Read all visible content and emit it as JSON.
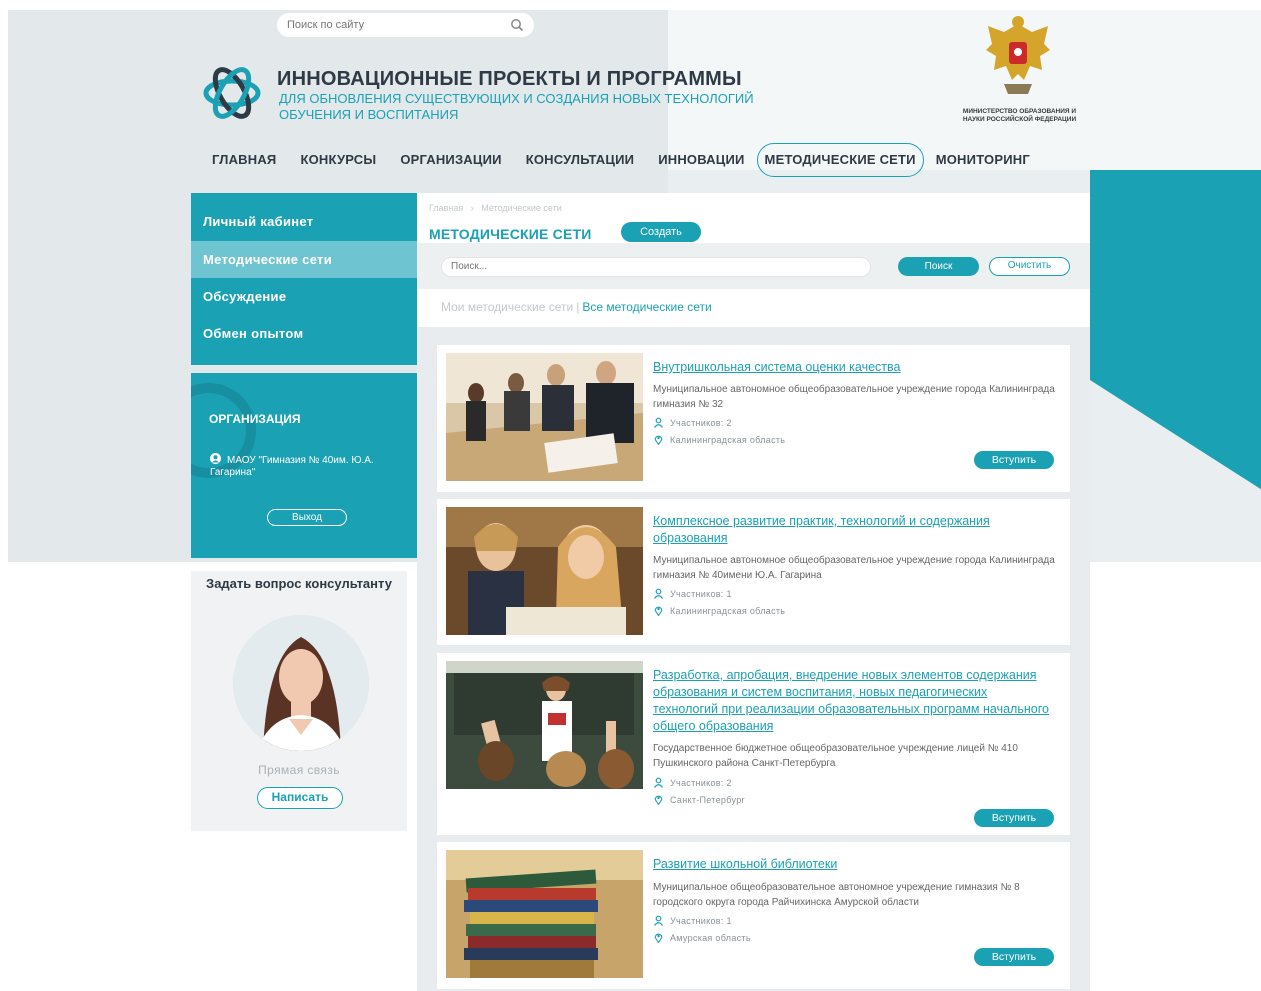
{
  "header": {
    "search_placeholder": "Поиск по сайту",
    "title": "ИННОВАЦИОННЫЕ ПРОЕКТЫ И ПРОГРАММЫ",
    "subtitle": "ДЛЯ ОБНОВЛЕНИЯ СУЩЕСТВУЮЩИХ И СОЗДАНИЯ НОВЫХ ТЕХНОЛОГИЙ ОБУЧЕНИЯ И ВОСПИТАНИЯ",
    "ministry": "МИНИСТЕРСТВО ОБРАЗОВАНИЯ И НАУКИ РОССИЙСКОЙ ФЕДЕРАЦИИ"
  },
  "nav": {
    "items": [
      {
        "label": "ГЛАВНАЯ"
      },
      {
        "label": "КОНКУРСЫ"
      },
      {
        "label": "ОРГАНИЗАЦИИ"
      },
      {
        "label": "КОНСУЛЬТАЦИИ"
      },
      {
        "label": "ИННОВАЦИИ"
      },
      {
        "label": "МЕТОДИЧЕСКИЕ СЕТИ"
      },
      {
        "label": "МОНИТОРИНГ"
      }
    ],
    "active": "МЕТОДИЧЕСКИЕ СЕТИ"
  },
  "sidebar": {
    "items": [
      {
        "label": "Личный кабинет"
      },
      {
        "label": "Методические сети"
      },
      {
        "label": "Обсуждение"
      },
      {
        "label": "Обмен опытом"
      }
    ],
    "org_title": "ОРГАНИЗАЦИЯ",
    "org_name": "МАОУ \"Гимназия № 40им. Ю.А. Гагарина\"",
    "logout_label": "Выход",
    "consult_title": "Задать вопрос консультанту",
    "direct_label": "Прямая связь",
    "write_label": "Написать"
  },
  "main": {
    "breadcrumb": {
      "home": "Главная",
      "sep": "›",
      "current": "Методические сети"
    },
    "title": "МЕТОДИЧЕСКИЕ СЕТИ",
    "create_label": "Создать",
    "search_placeholder": "Поиск...",
    "search_label": "Поиск",
    "clear_label": "Очистить",
    "tabs": {
      "mine": "Мои методические сети",
      "sep": "|",
      "all": "Все методические сети"
    },
    "cards": [
      {
        "title": "Внутришкольная система оценки качества",
        "desc": "Муниципальное автономное общеобразовательное учреждение города Калининграда гимназия № 32",
        "participants": "Участников: 2",
        "region": "Калининградская область",
        "join_label": "Вступить"
      },
      {
        "title": "Комплексное развитие практик, технологий и содержания образования",
        "desc": "Муниципальное автономное общеобразовательное учреждение города Калининграда гимназия № 40имени Ю.А. Гагарина",
        "participants": "Участников: 1",
        "region": "Калининградская область"
      },
      {
        "title": "Разработка, апробация, внедрение новых элементов содержания образования и систем воспитания, новых педагогических технологий при реализации образовательных программ начального общего образования",
        "desc": "Государственное бюджетное общеобразовательное учреждение лицей № 410 Пушкинского района Санкт-Петербурга",
        "participants": "Участников: 2",
        "region": "Санкт-Петербург",
        "join_label": "Вступить"
      },
      {
        "title": "Развитие школьной библиотеки",
        "desc": "Муниципальное общеобразовательное автономное учреждение гимназия № 8 городского округа города Райчихинска Амурской области",
        "participants": "Участников: 1",
        "region": "Амурская область",
        "join_label": "Вступить"
      }
    ]
  },
  "colors": {
    "accent": "#1ba1b4",
    "accent_light": "#6fc4d1",
    "text_dark": "#2e3a45",
    "bg": "#e9eef0"
  }
}
